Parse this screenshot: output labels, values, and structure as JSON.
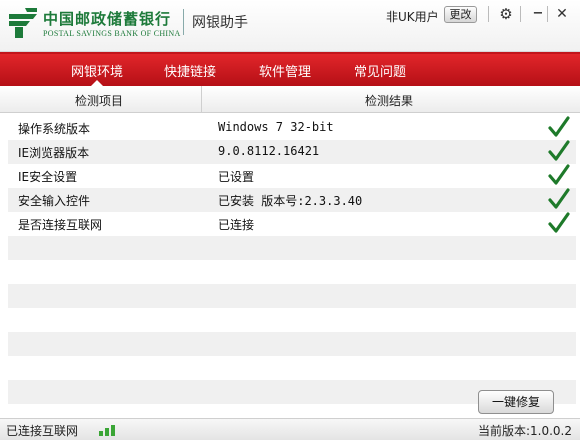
{
  "app": {
    "bank_name_cn": "中国邮政储蓄银行",
    "bank_name_en": "POSTAL SAVINGS BANK OF CHINA",
    "title": "网银助手",
    "brand_green": "#1d7a3a",
    "brand_red": "#d61f26"
  },
  "header": {
    "user_status": "非UK用户",
    "change_label": "更改",
    "settings_icon": "gear-icon",
    "minimize_icon": "minimize-icon",
    "close_icon": "close-icon"
  },
  "nav": {
    "tabs": [
      {
        "label": "网银环境",
        "active": true
      },
      {
        "label": "快捷链接",
        "active": false
      },
      {
        "label": "软件管理",
        "active": false
      },
      {
        "label": "常见问题",
        "active": false
      }
    ]
  },
  "table": {
    "columns": [
      "检测项目",
      "检测结果"
    ],
    "rows": [
      {
        "item": "操作系统版本",
        "result": "Windows 7 32-bit",
        "ok": true
      },
      {
        "item": "IE浏览器版本",
        "result": "9.0.8112.16421",
        "ok": true
      },
      {
        "item": "IE安全设置",
        "result": "已设置",
        "ok": true
      },
      {
        "item": "安全输入控件",
        "result": "已安装 版本号:2.3.3.40",
        "ok": true
      },
      {
        "item": "是否连接互联网",
        "result": "已连接",
        "ok": true
      }
    ]
  },
  "footer": {
    "fix_button": "一键修复",
    "connection_status": "已连接互联网",
    "version": "当前版本:1.0.0.2"
  }
}
